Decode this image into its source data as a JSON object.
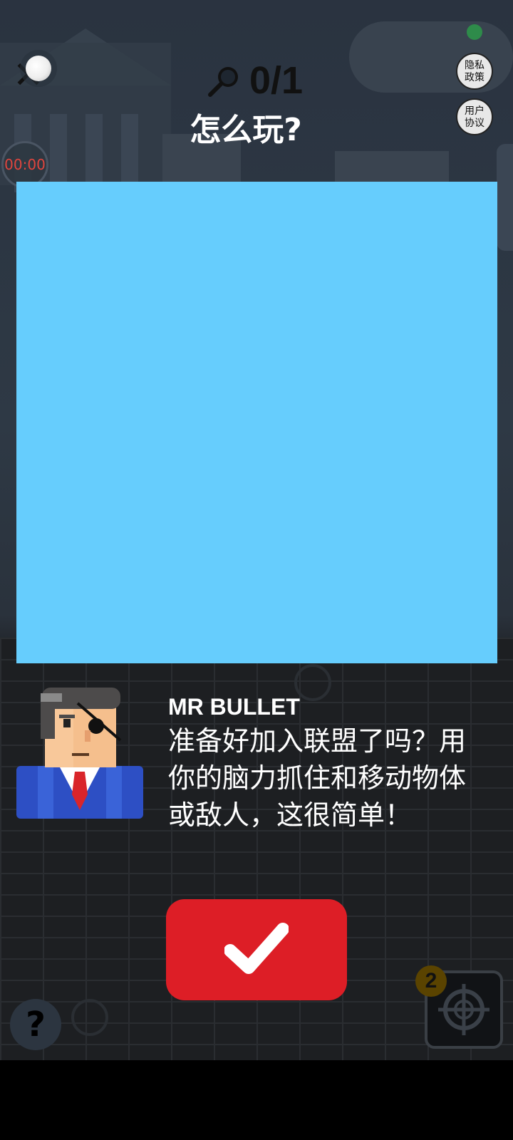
{
  "top_bar": {
    "score": "0/1",
    "privacy_label_line1": "隐私",
    "privacy_label_line2": "政策",
    "agreement_label_line1": "用户",
    "agreement_label_line2": "协议",
    "timer": "00:00"
  },
  "tutorial": {
    "title": "怎么玩?",
    "speaker_name": "MR BULLET",
    "dialog": "准备好加入联盟了吗？用你的脑力抓住和移动物体或敌人，这很简单！"
  },
  "controls": {
    "help_label": "?",
    "ammo_count": "2"
  },
  "colors": {
    "panel": "#66cdfd",
    "confirm": "#dd1e26",
    "timer_text": "#e0453e"
  },
  "icons": {
    "close": "close-icon",
    "magnifier": "magnifier-icon",
    "confirm": "checkmark-icon",
    "target": "crosshair-icon"
  }
}
